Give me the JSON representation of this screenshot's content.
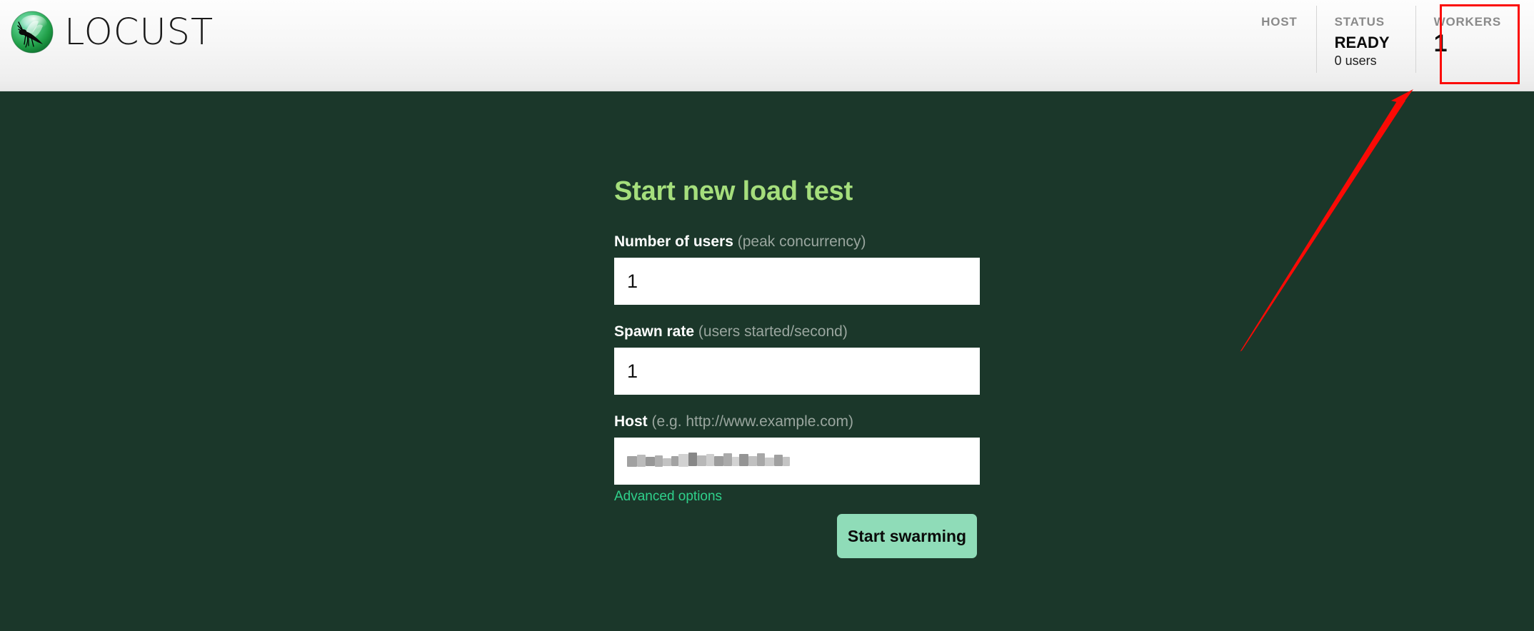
{
  "app": {
    "brand_name": "LOCUST",
    "logo_icon": "locust-logo-icon"
  },
  "header": {
    "stats": [
      {
        "label": "HOST",
        "value": "",
        "sub": ""
      },
      {
        "label": "STATUS",
        "value": "READY",
        "sub": "0 users"
      },
      {
        "label": "WORKERS",
        "value": "1",
        "sub": ""
      }
    ]
  },
  "form": {
    "title": "Start new load test",
    "fields": [
      {
        "label": "Number of users",
        "hint": "(peak concurrency)",
        "value": "1",
        "placeholder": ""
      },
      {
        "label": "Spawn rate",
        "hint": "(users started/second)",
        "value": "1",
        "placeholder": ""
      },
      {
        "label": "Host",
        "hint": "(e.g. http://www.example.com)",
        "value": "",
        "placeholder": "",
        "redacted": true
      }
    ],
    "advanced_options_label": "Advanced options",
    "submit_label": "Start swarming"
  },
  "annotation": {
    "highlight_target": "WORKERS",
    "arrow_color": "#fb0a05",
    "box_color": "#fb0a05"
  },
  "colors": {
    "background_green": "#1b372a",
    "title_green": "#a5de7c",
    "link_green": "#2fd18b",
    "button_green": "#8fdcb8",
    "header_gray": "#8a8a8a"
  }
}
